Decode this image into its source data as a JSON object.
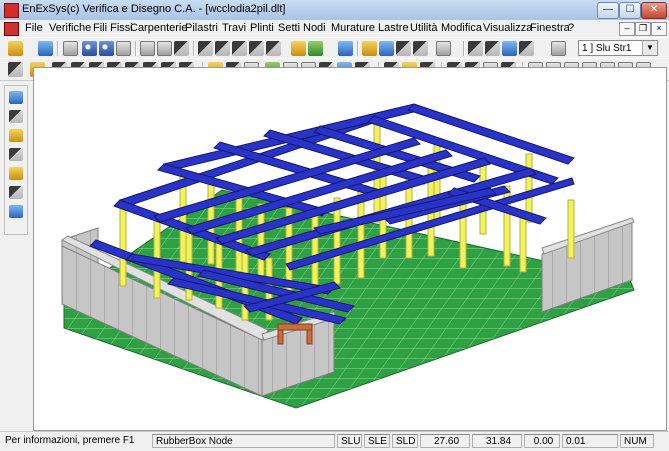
{
  "window": {
    "title": "EnExSys(c) Verifica e Disegno C.A. - [wcclodia2pil.dlt]",
    "min_glyph": "—",
    "max_glyph": "☐",
    "close_glyph": "✕"
  },
  "menubar": {
    "items": [
      "File",
      "Verifiche",
      "Fili Fissi",
      "Carpenterie",
      "Pilastri",
      "Travi",
      "Plinti",
      "Setti",
      "Nodi",
      "Murature",
      "Lastre",
      "Utilità",
      "Modifica",
      "Visualizza",
      "Finestra",
      "?"
    ],
    "mdi_min_glyph": "–",
    "mdi_restore_glyph": "❐",
    "mdi_close_glyph": "×"
  },
  "toolbar": {
    "combo_value": "1 ] Slu Str1",
    "combo_arrow_glyph": "▼"
  },
  "statusbar": {
    "help": "Per informazioni, premere F1",
    "mode": "RubberBox Node",
    "slu": "SLU",
    "sle": "SLE",
    "sld": "SLD",
    "x": "27.60",
    "y": "31.84",
    "v1": "0.00",
    "v2": "0.01",
    "num": "NUM"
  },
  "colors": {
    "floor_green": "#2fa043",
    "floor_line": "#7fd07f",
    "wall_gray": "#c6c6c6",
    "beam_blue": "#2933c8",
    "column_yellow": "#f2f25a",
    "accent_red": "#c86e3c"
  }
}
